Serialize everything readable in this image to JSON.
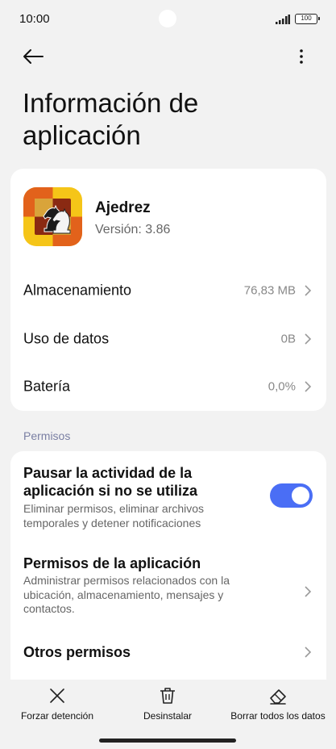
{
  "status_bar": {
    "time": "10:00",
    "battery": "100"
  },
  "header": {
    "title": "Información de aplicación"
  },
  "app": {
    "name": "Ajedrez",
    "version": "Versión: 3.86",
    "icon": "chess-knight-icon"
  },
  "storage_rows": [
    {
      "label": "Almacenamiento",
      "value": "76,83 MB"
    },
    {
      "label": "Uso de datos",
      "value": "0B"
    },
    {
      "label": "Batería",
      "value": "0,0%"
    }
  ],
  "permissions": {
    "section_label": "Permisos",
    "pause": {
      "title": "Pausar la actividad de la aplicación si no se utiliza",
      "description": "Eliminar permisos, eliminar archivos temporales y detener notificaciones",
      "enabled": true
    },
    "app_permissions": {
      "title": "Permisos de la aplicación",
      "description": "Administrar permisos relacionados con la ubicación, almacenamiento, mensajes y contactos."
    },
    "other": {
      "title": "Otros permisos"
    }
  },
  "bottom_actions": [
    {
      "label": "Forzar detención",
      "icon": "close-icon"
    },
    {
      "label": "Desinstalar",
      "icon": "trash-icon"
    },
    {
      "label": "Borrar todos los datos",
      "icon": "eraser-icon"
    }
  ],
  "colors": {
    "accent": "#4a6ef5",
    "background": "#f2f2f2",
    "card": "#ffffff"
  }
}
